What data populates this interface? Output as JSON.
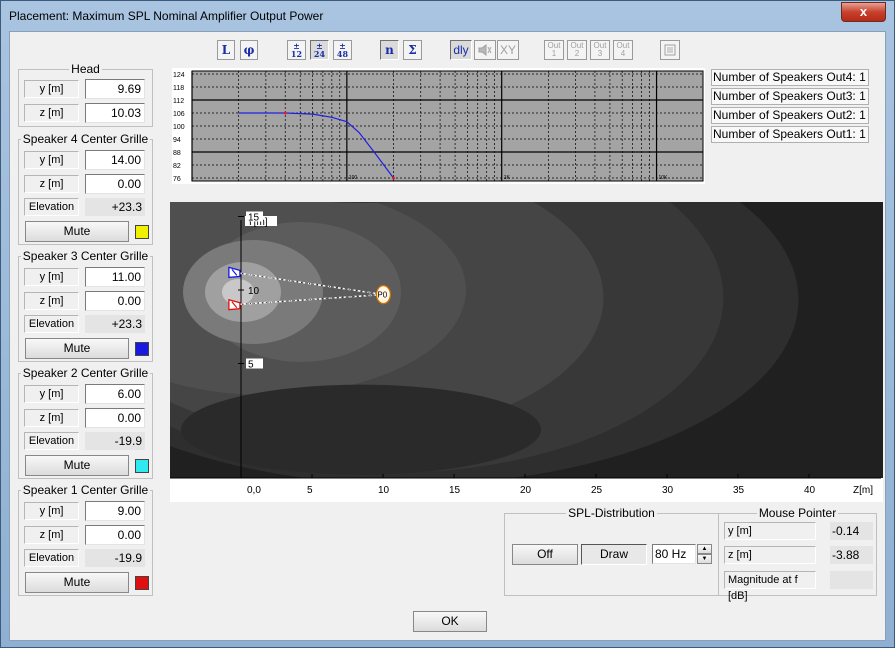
{
  "window": {
    "title": "Placement: Maximum SPL Nominal Amplifier Output Power",
    "close_label": "x"
  },
  "head": {
    "title": "Head",
    "y_label": "y [m]",
    "y_value": "9.69",
    "z_label": "z [m]",
    "z_value": "10.03"
  },
  "speakers": [
    {
      "title": "Speaker 4 Center Grille",
      "y_label": "y [m]",
      "y_value": "14.00",
      "z_label": "z [m]",
      "z_value": "0.00",
      "elev_label": "Elevation",
      "elev_value": "+23.3",
      "mute_label": "Mute",
      "color": "#f0f000"
    },
    {
      "title": "Speaker 3 Center Grille",
      "y_label": "y [m]",
      "y_value": "11.00",
      "z_label": "z [m]",
      "z_value": "0.00",
      "elev_label": "Elevation",
      "elev_value": "+23.3",
      "mute_label": "Mute",
      "color": "#1818e0"
    },
    {
      "title": "Speaker 2 Center Grille",
      "y_label": "y [m]",
      "y_value": "6.00",
      "z_label": "z [m]",
      "z_value": "0.00",
      "elev_label": "Elevation",
      "elev_value": "-19.9",
      "mute_label": "Mute",
      "color": "#30e8f0"
    },
    {
      "title": "Speaker 1 Center Grille",
      "y_label": "y [m]",
      "y_value": "9.00",
      "z_label": "z [m]",
      "z_value": "0.00",
      "elev_label": "Elevation",
      "elev_value": "-19.9",
      "mute_label": "Mute",
      "color": "#e01010"
    }
  ],
  "toolbar": {
    "l": "L",
    "phi": "φ",
    "oct12": "12",
    "oct24": "24",
    "oct48": "48",
    "n": "n",
    "sigma": "Σ",
    "dly": "dly",
    "xy": "XY",
    "out_label": "Out",
    "out1": "1",
    "out2": "2",
    "out3": "3",
    "out4": "4"
  },
  "info": [
    "Number of Speakers Out4: 1",
    "Number of Speakers Out3: 1",
    "Number of Speakers Out2: 1",
    "Number of Speakers Out1: 1"
  ],
  "response_chart": {
    "y_ticks": [
      "124",
      "118",
      "112",
      "106",
      "100",
      "94",
      "88",
      "82",
      "76"
    ],
    "x_ticks": [
      "100",
      "1K",
      "10K"
    ],
    "curve": {
      "x_hz": [
        20,
        40,
        60,
        80,
        100,
        120,
        150,
        200
      ],
      "y_db": [
        106,
        106,
        105.5,
        104,
        102,
        97,
        88,
        76
      ]
    },
    "colors": {
      "curve": "#2020e0",
      "marker": "#e02020"
    }
  },
  "chart_data": {
    "type": "heatmap",
    "title": "",
    "xlabel": "Z[m]",
    "ylabel": "Y[m]",
    "x_ticks": [
      "0,0",
      "5",
      "10",
      "15",
      "20",
      "25",
      "30",
      "35",
      "40"
    ],
    "y_ticks": [
      "15",
      "10",
      "5"
    ],
    "xlim": [
      -5,
      45
    ],
    "ylim": [
      0,
      18
    ],
    "grid": false,
    "head": {
      "z": 10.03,
      "y": 9.69,
      "label": "P0"
    },
    "speakers": [
      {
        "name": "Speaker 3",
        "z": -0.5,
        "y": 11.2,
        "color": "#1818e0"
      },
      {
        "name": "Speaker 1",
        "z": -0.5,
        "y": 9.0,
        "color": "#e01010"
      }
    ]
  },
  "spl": {
    "title": "SPL-Distribution",
    "off_label": "Off",
    "draw_label": "Draw",
    "freq_value": "80 Hz"
  },
  "mouse": {
    "title": "Mouse Pointer",
    "y_label": "y [m]",
    "y_value": "-0.14",
    "z_label": "z [m]",
    "z_value": "-3.88",
    "mag_label": "Magnitude at f [dB]",
    "mag_value": ""
  },
  "ok_label": "OK"
}
